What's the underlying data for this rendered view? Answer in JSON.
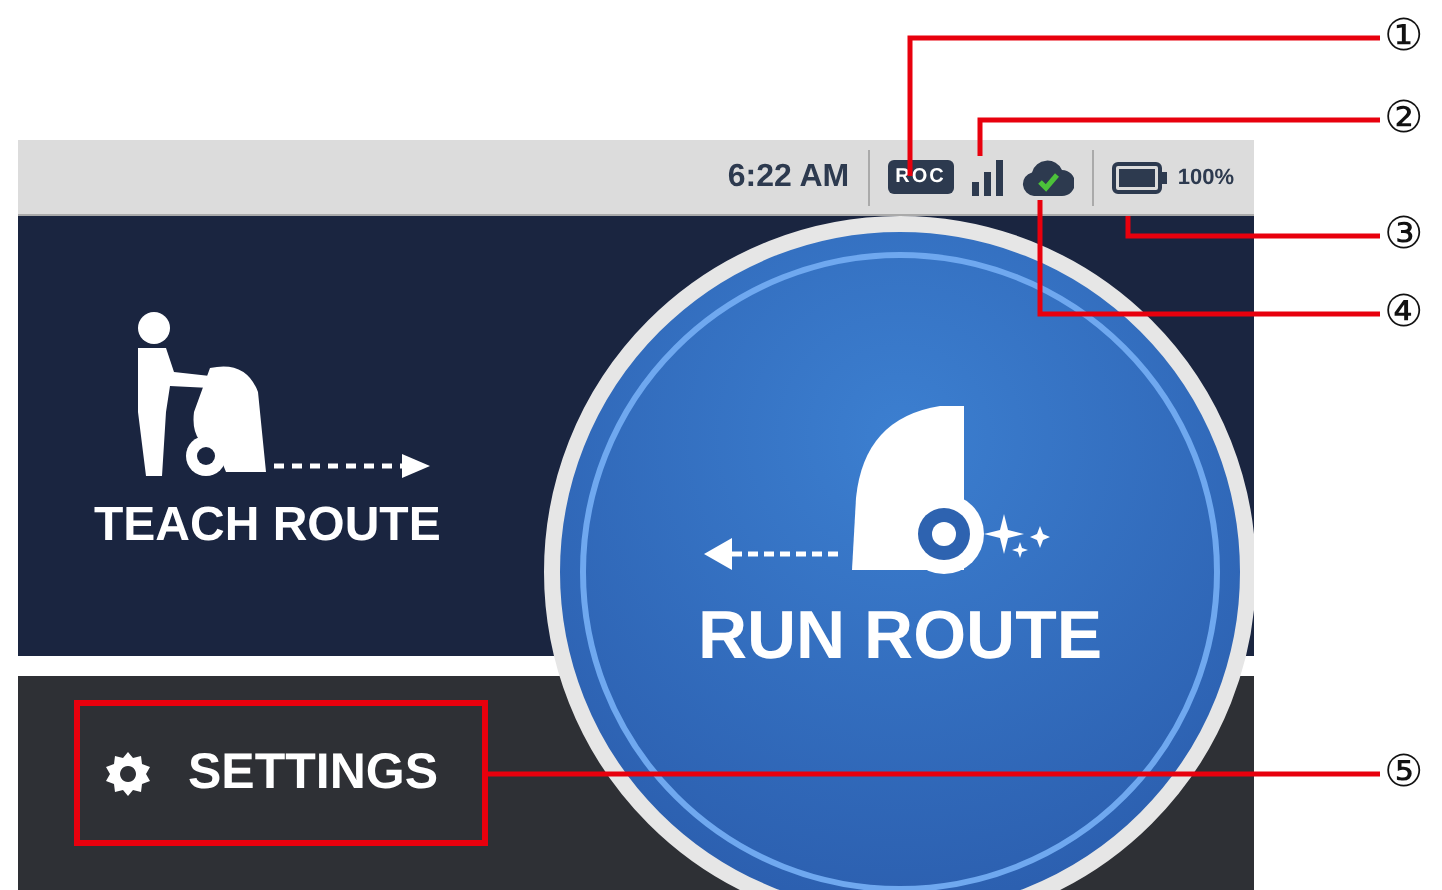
{
  "status_bar": {
    "time": "6:22 AM",
    "connection_badge": "ROC",
    "battery_text": "100%",
    "cloud_synced": true
  },
  "teach_button": {
    "label": "TEACH ROUTE"
  },
  "run_button": {
    "label": "RUN ROUTE"
  },
  "settings_button": {
    "label": "SETTINGS",
    "highlighted": true
  },
  "callouts": [
    {
      "number": "①"
    },
    {
      "number": "②"
    },
    {
      "number": "③"
    },
    {
      "number": "④"
    },
    {
      "number": "⑤"
    }
  ]
}
